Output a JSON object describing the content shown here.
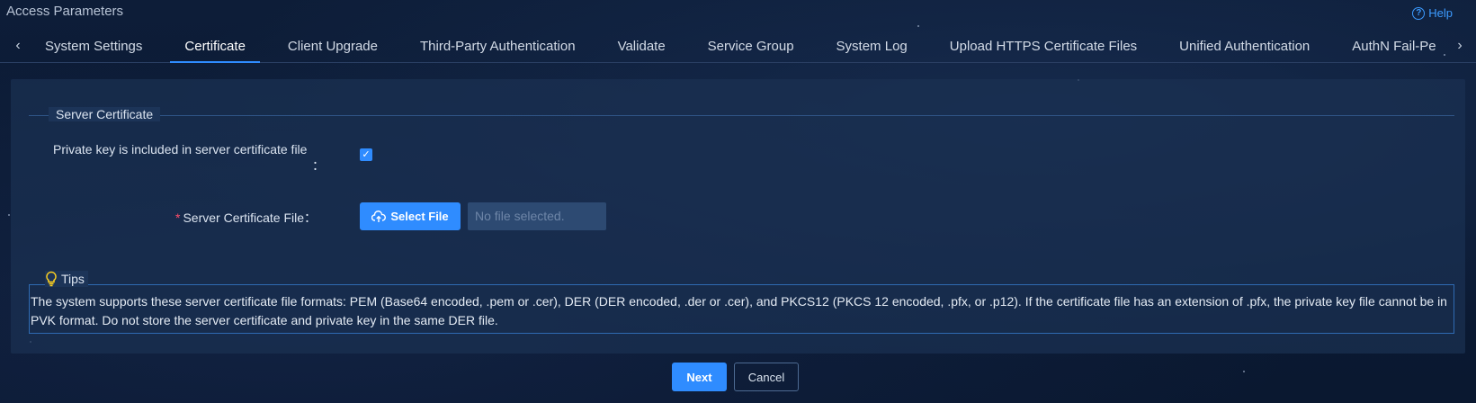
{
  "app": {
    "title": "Access Parameters",
    "help_label": "Help"
  },
  "tabs": [
    {
      "label": "System Settings"
    },
    {
      "label": "Certificate",
      "active": true
    },
    {
      "label": "Client Upgrade"
    },
    {
      "label": "Third-Party Authentication"
    },
    {
      "label": "Validate"
    },
    {
      "label": "Service Group"
    },
    {
      "label": "System Log"
    },
    {
      "label": "Upload HTTPS Certificate Files"
    },
    {
      "label": "Unified Authentication"
    },
    {
      "label": "AuthN Fail-Pe"
    }
  ],
  "server_certificate": {
    "section_title": "Server Certificate",
    "private_key_label": "Private key is included in server certificate file",
    "private_key_colon": "：",
    "private_key_checked": true,
    "file_label": "Server Certificate File：",
    "required_mark": "*",
    "select_file_label": "Select File",
    "file_placeholder": "No file selected."
  },
  "tips": {
    "title": "Tips",
    "text": "The system supports these server certificate file formats: PEM (Base64 encoded, .pem or .cer), DER (DER encoded, .der or .cer), and PKCS12 (PKCS 12 encoded, .pfx, or .p12). If the certificate file has an extension of .pfx, the private key file cannot be in PVK format. Do not store the server certificate and private key in the same DER file."
  },
  "actions": {
    "next_label": "Next",
    "cancel_label": "Cancel"
  },
  "colors": {
    "accent": "#2f8cff",
    "required": "#ff4d6a",
    "tips_icon": "#ffd21e"
  }
}
